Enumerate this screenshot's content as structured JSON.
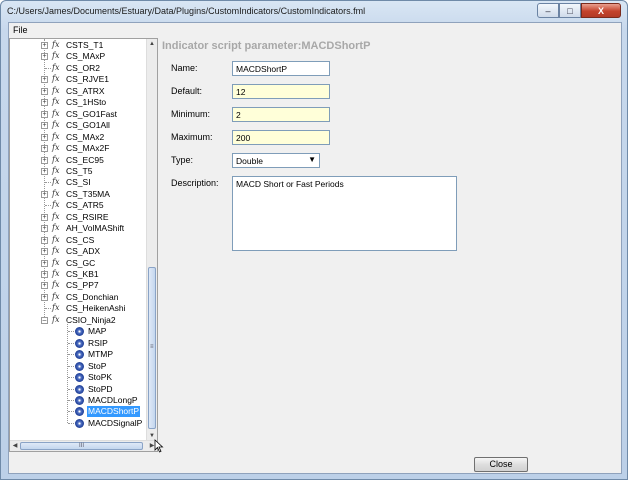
{
  "window": {
    "title": "C:/Users/James/Documents/Estuary/Data/Plugins/CustomIndicators/CustomIndicators.fml",
    "minimize_glyph": "–",
    "maximize_glyph": "□",
    "close_glyph": "X"
  },
  "menu": {
    "file": "File"
  },
  "tree": {
    "items": [
      {
        "label": "CSTS_T1",
        "expandable": true
      },
      {
        "label": "CS_MAxP",
        "expandable": true
      },
      {
        "label": "CS_OR2",
        "expandable": false
      },
      {
        "label": "CS_RJVE1",
        "expandable": true
      },
      {
        "label": "CS_ATRX",
        "expandable": true
      },
      {
        "label": "CS_1HSto",
        "expandable": true
      },
      {
        "label": "CS_GO1Fast",
        "expandable": true
      },
      {
        "label": "CS_GO1All",
        "expandable": true
      },
      {
        "label": "CS_MAx2",
        "expandable": true
      },
      {
        "label": "CS_MAx2F",
        "expandable": true
      },
      {
        "label": "CS_EC95",
        "expandable": true
      },
      {
        "label": "CS_T5",
        "expandable": true
      },
      {
        "label": "CS_SI",
        "expandable": false
      },
      {
        "label": "CS_T35MA",
        "expandable": true
      },
      {
        "label": "CS_ATR5",
        "expandable": false
      },
      {
        "label": "CS_RSIRE",
        "expandable": true
      },
      {
        "label": "AH_VolMAShift",
        "expandable": true
      },
      {
        "label": "CS_CS",
        "expandable": true
      },
      {
        "label": "CS_ADX",
        "expandable": true
      },
      {
        "label": "CS_GC",
        "expandable": true
      },
      {
        "label": "CS_KB1",
        "expandable": true
      },
      {
        "label": "CS_PP7",
        "expandable": true
      },
      {
        "label": "CS_Donchian",
        "expandable": true
      },
      {
        "label": "CS_HeikenAshi",
        "expandable": false
      },
      {
        "label": "CSIO_Ninja2",
        "expandable": true,
        "expanded": true
      }
    ],
    "children": [
      {
        "label": "MAP"
      },
      {
        "label": "RSIP"
      },
      {
        "label": "MTMP"
      },
      {
        "label": "StoP"
      },
      {
        "label": "StoPK"
      },
      {
        "label": "StoPD"
      },
      {
        "label": "MACDLongP"
      },
      {
        "label": "MACDShortP",
        "selected": true
      },
      {
        "label": "MACDSignalP"
      }
    ],
    "expand_glyph": "+",
    "collapse_glyph": "–",
    "fx_glyph": "fx",
    "scroll_up": "▲",
    "scroll_down": "▼",
    "scroll_left": "◀",
    "scroll_right": "▶",
    "vscroll_grip": "≡",
    "hscroll_grip": "III"
  },
  "detail": {
    "heading": "Indicator script parameter:MACDShortP",
    "name_label": "Name:",
    "name_value": "MACDShortP",
    "default_label": "Default:",
    "default_value": "12",
    "minimum_label": "Minimum:",
    "minimum_value": "2",
    "maximum_label": "Maximum:",
    "maximum_value": "200",
    "type_label": "Type:",
    "type_value": "Double",
    "type_caret": "▼",
    "description_label": "Description:",
    "description_value": "MACD Short or Fast Periods"
  },
  "footer": {
    "close_label": "Close"
  },
  "colors": {
    "selection": "#3399ff",
    "highlight_field": "#ffffd9",
    "heading_text": "#a8a8a8"
  }
}
